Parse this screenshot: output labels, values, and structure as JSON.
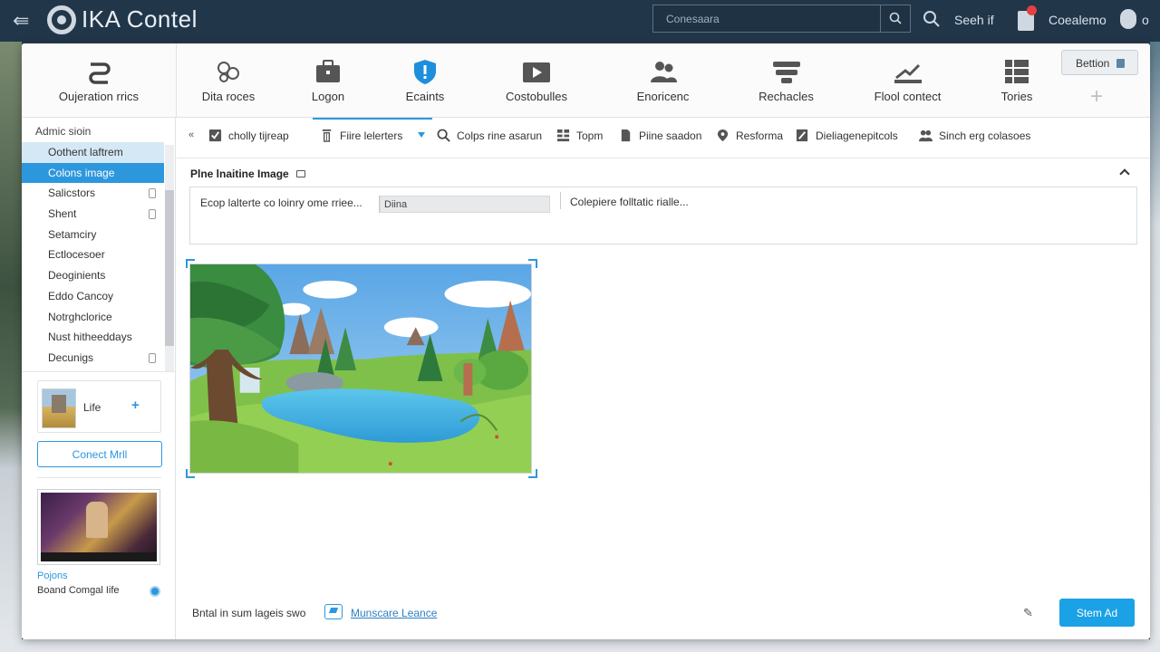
{
  "app": {
    "title": "IKA Contel",
    "search_placeholder": "Conesaara",
    "search_link": "Seeh if",
    "user_label": "Coealemo",
    "user_suffix": "o"
  },
  "toolbar": {
    "items": [
      {
        "label": "Oujeration rrics",
        "icon": "sync-icon"
      },
      {
        "label": "Dita roces",
        "icon": "data-link-icon"
      },
      {
        "label": "Logon",
        "icon": "briefcase-icon"
      },
      {
        "label": "Ecaints",
        "icon": "shield-icon"
      },
      {
        "label": "Costobulles",
        "icon": "video-icon"
      },
      {
        "label": "Enoricenc",
        "icon": "users-icon"
      },
      {
        "label": "Rechacles",
        "icon": "stack-icon"
      },
      {
        "label": "Flool contect",
        "icon": "chart-icon"
      },
      {
        "label": "Tories",
        "icon": "grid-icon"
      }
    ],
    "section_button": "Bettion",
    "add_symbol": "+"
  },
  "sidebar": {
    "heading": "Admic sioin",
    "items": [
      {
        "label": "Oothent laftrem",
        "state": "light",
        "lock": false
      },
      {
        "label": "Colons image",
        "state": "active",
        "lock": false
      },
      {
        "label": "Salicstors",
        "state": "",
        "lock": true
      },
      {
        "label": "Shent",
        "state": "",
        "lock": true
      },
      {
        "label": "Setamciry",
        "state": "",
        "lock": false
      },
      {
        "label": "Ectlocesoer",
        "state": "",
        "lock": false
      },
      {
        "label": "Deoginients",
        "state": "",
        "lock": false
      },
      {
        "label": "Eddo Cancoy",
        "state": "",
        "lock": false
      },
      {
        "label": "Notrghclorice",
        "state": "",
        "lock": false
      },
      {
        "label": "Nust hitheeddays",
        "state": "",
        "lock": false
      },
      {
        "label": "Decunigs",
        "state": "",
        "lock": true
      }
    ],
    "card_label": "Life",
    "card_plus": "+",
    "connect_button": "Conect Mrll",
    "pojons": "Pojons",
    "brand_label": "Boand Comgal Iife"
  },
  "subbar": {
    "collapse_symbol": "«",
    "items": [
      {
        "label": "cholly tijreap",
        "icon": "check-box-icon"
      },
      {
        "label": "Fiire lelerters",
        "icon": "filter-icon"
      },
      {
        "label": "Colps rine asarun",
        "icon": "search-icon"
      },
      {
        "label": "Topm",
        "icon": "grid-icon"
      },
      {
        "label": "Piine saadon",
        "icon": "document-icon"
      },
      {
        "label": "Resforma",
        "icon": "pin-icon"
      },
      {
        "label": "Dieliagenepitcols",
        "icon": "edit-icon"
      },
      {
        "label": "Sinch erg colasoes",
        "icon": "users-icon"
      }
    ]
  },
  "main": {
    "title": "Plne lnaitine Image",
    "field_left": "Ecop lalterte co loinry ome rriee...",
    "field_input": "Diina",
    "field_right": "Colepiere folltatic rialle..."
  },
  "footer": {
    "note": "Bntal in sum lageis swo",
    "link": "Munscare Leance",
    "edit_symbol": "✎",
    "primary_button": "Stem Ad"
  },
  "colors": {
    "accent": "#2d97de",
    "primary_button": "#1aa1e6",
    "header_bg": "#22364a"
  }
}
